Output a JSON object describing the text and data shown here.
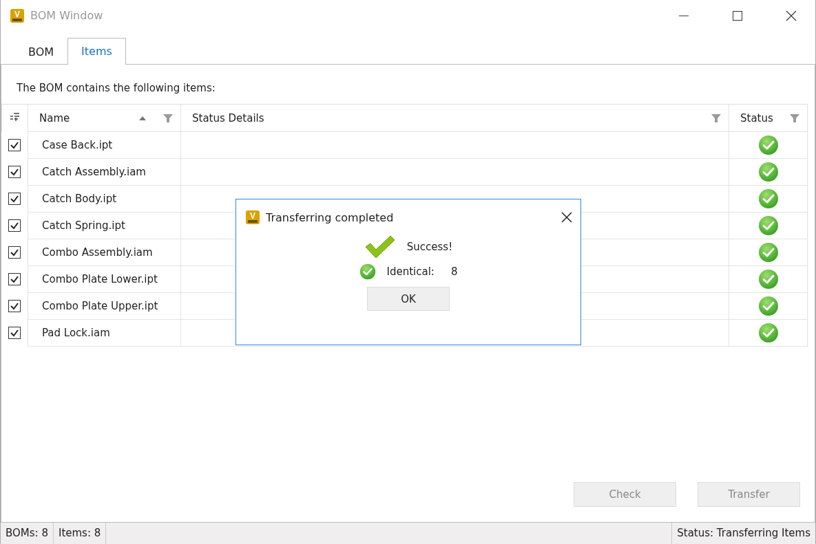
{
  "window": {
    "logo": "V",
    "title": "BOM Window"
  },
  "tabs": [
    {
      "label": "BOM",
      "selected": false
    },
    {
      "label": "Items",
      "selected": true
    }
  ],
  "intro": "The BOM contains the following items:",
  "table": {
    "columns": [
      {
        "label": "Name",
        "sorted": true,
        "filter": true
      },
      {
        "label": "Status Details",
        "sorted": false,
        "filter": true
      },
      {
        "label": "Status",
        "sorted": false,
        "filter": true
      }
    ],
    "rows": [
      {
        "checked": true,
        "name": "Case Back.ipt"
      },
      {
        "checked": true,
        "name": "Catch Assembly.iam"
      },
      {
        "checked": true,
        "name": "Catch Body.ipt"
      },
      {
        "checked": true,
        "name": "Catch Spring.ipt"
      },
      {
        "checked": true,
        "name": "Combo Assembly.iam"
      },
      {
        "checked": true,
        "name": "Combo Plate Lower.ipt"
      },
      {
        "checked": true,
        "name": "Combo Plate Upper.ipt"
      },
      {
        "checked": true,
        "name": "Pad Lock.iam"
      }
    ]
  },
  "buttons": [
    {
      "label": "Check",
      "disabled": true
    },
    {
      "label": "Transfer",
      "disabled": true
    }
  ],
  "status_bar": {
    "left": [
      "BOMs: 8",
      "Items: 8"
    ],
    "right": "Status: Transferring Items"
  },
  "dialog": {
    "logo": "V",
    "title": "Transferring completed",
    "message": "Success!",
    "result_label": "Identical:",
    "result_value": "8",
    "button": "OK"
  }
}
